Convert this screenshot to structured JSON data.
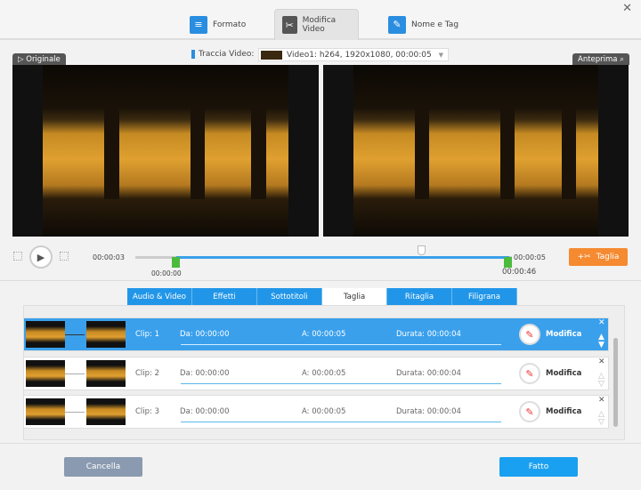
{
  "top_tabs": [
    {
      "label": "Formato",
      "icon": "format-icon"
    },
    {
      "label": "Modifica Video",
      "icon": "edit-video-icon"
    },
    {
      "label": "Nome e Tag",
      "icon": "name-tag-icon"
    }
  ],
  "track": {
    "label": "Traccia Video:",
    "value": "Video1: h264, 1920x1080, 00:00:05"
  },
  "preview": {
    "original_label": "Originale",
    "preview_label": "Anteprima"
  },
  "timeline": {
    "current": "00:00:03",
    "start": "00:00:00",
    "end": "00:00:05",
    "end_marker": "00:00:46",
    "cut_label": "Taglia",
    "selection_start_fraction": 0.11,
    "selection_end_fraction": 0.99,
    "playhead_fraction": 0.77
  },
  "bottom_tabs": [
    "Audio & Video",
    "Effetti",
    "Sottotitoli",
    "Taglia",
    "Ritaglia",
    "Filigrana"
  ],
  "clips": [
    {
      "name": "Clip: 1",
      "from": "Da:  00:00:00",
      "to": "A:  00:00:05",
      "duration": "Durata: 00:00:04",
      "edit": "Modifica"
    },
    {
      "name": "Clip: 2",
      "from": "Da:  00:00:00",
      "to": "A:  00:00:05",
      "duration": "Durata: 00:00:04",
      "edit": "Modifica"
    },
    {
      "name": "Clip: 3",
      "from": "Da:  00:00:00",
      "to": "A:  00:00:05",
      "duration": "Durata: 00:00:04",
      "edit": "Modifica"
    }
  ],
  "buttons": {
    "cancel": "Cancella",
    "done": "Fatto"
  }
}
